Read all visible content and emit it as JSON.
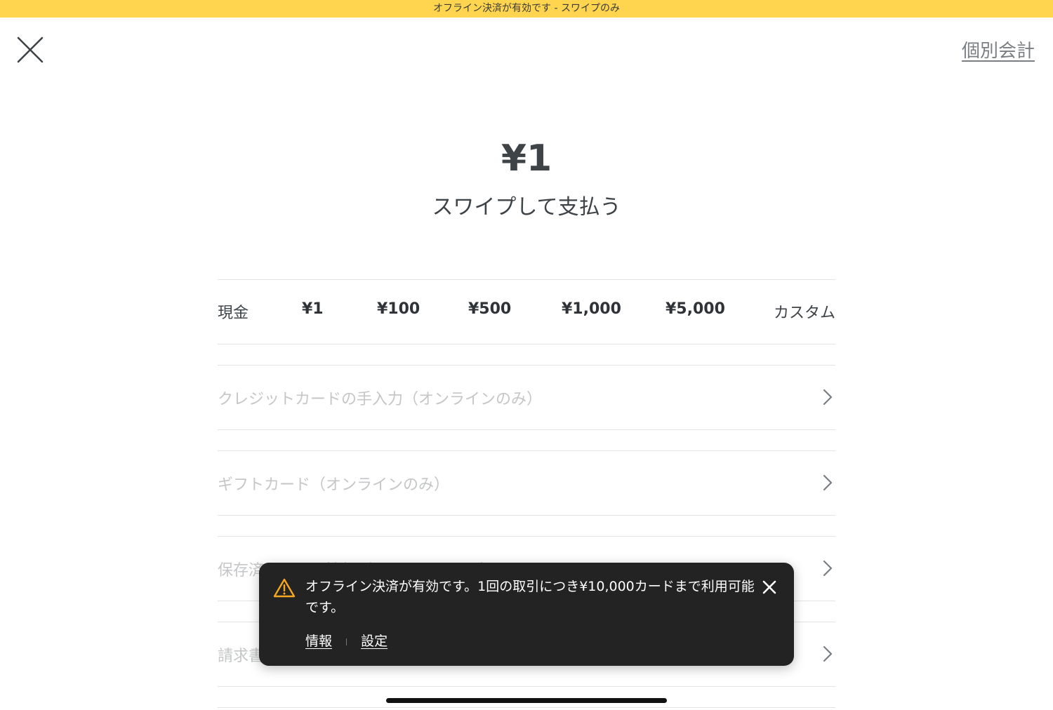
{
  "banner": {
    "text": "オフライン決済が有効です - スワイプのみ",
    "color": "#ffd54f"
  },
  "header": {
    "close_icon": "close-icon",
    "split_label": "個別会計"
  },
  "payment": {
    "amount": "¥1",
    "prompt": "スワイプして支払う"
  },
  "cash": {
    "label": "現金",
    "options": [
      "¥1",
      "¥100",
      "¥500",
      "¥1,000",
      "¥5,000"
    ],
    "custom_label": "カスタム"
  },
  "methods": [
    {
      "label": "クレジットカードの手入力（オンラインのみ）",
      "icon": "chevron-right-icon"
    },
    {
      "label": "ギフトカード（オンラインのみ）",
      "icon": "chevron-right-icon"
    },
    {
      "label": "保存済みカード情報（オンラインのみ）",
      "icon": "chevron-right-icon"
    },
    {
      "label": "請求書",
      "icon": "chevron-right-icon"
    }
  ],
  "toast": {
    "icon": "warning-icon",
    "message": "オフライン決済が有効です。1回の取引につき¥10,000カードまで利用可能です。",
    "info_link": "情報",
    "settings_link": "設定",
    "close_icon": "close-icon",
    "warning_color": "#f5a623"
  }
}
